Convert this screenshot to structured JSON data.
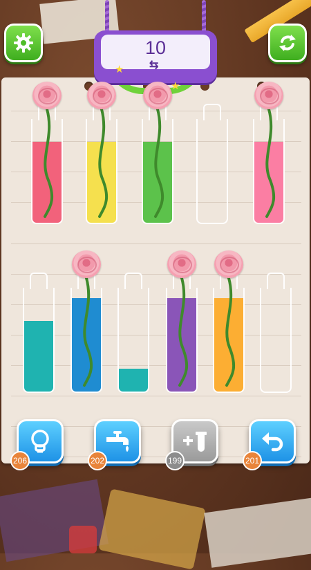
{
  "header": {
    "settings_icon": "gear-icon",
    "restart_icon": "refresh-icon",
    "level_number": "10",
    "swap_icon": "swap-arrows-icon",
    "stars": 2
  },
  "bottles": [
    {
      "id": 1,
      "color": "#f2627b",
      "fill": 0.78,
      "has_flower": true
    },
    {
      "id": 2,
      "color": "#f5e04e",
      "fill": 0.78,
      "has_flower": true
    },
    {
      "id": 3,
      "color": "#5cc24b",
      "fill": 0.78,
      "has_flower": true
    },
    {
      "id": 4,
      "color": "",
      "fill": 0,
      "has_flower": false
    },
    {
      "id": 5,
      "color": "#fb7ea3",
      "fill": 0.78,
      "has_flower": true
    },
    {
      "id": 6,
      "color": "#1fb3b0",
      "fill": 0.68,
      "has_flower": false
    },
    {
      "id": 7,
      "color": "#1f8cd1",
      "fill": 0.9,
      "has_flower": true
    },
    {
      "id": 8,
      "color": "#1fb3b0",
      "fill": 0.22,
      "has_flower": false
    },
    {
      "id": 9,
      "color": "#8a55b8",
      "fill": 0.9,
      "has_flower": true
    },
    {
      "id": 10,
      "color": "#fcae33",
      "fill": 0.9,
      "has_flower": true
    },
    {
      "id": 11,
      "color": "",
      "fill": 0,
      "has_flower": false
    }
  ],
  "tools": [
    {
      "name": "hint",
      "icon": "lightbulb-icon",
      "count": "206",
      "style": "blue"
    },
    {
      "name": "faucet",
      "icon": "faucet-icon",
      "count": "202",
      "style": "blue"
    },
    {
      "name": "add-bottle",
      "icon": "add-tube-icon",
      "count": "199",
      "style": "grey"
    },
    {
      "name": "undo",
      "icon": "undo-icon",
      "count": "201",
      "style": "blue"
    }
  ]
}
